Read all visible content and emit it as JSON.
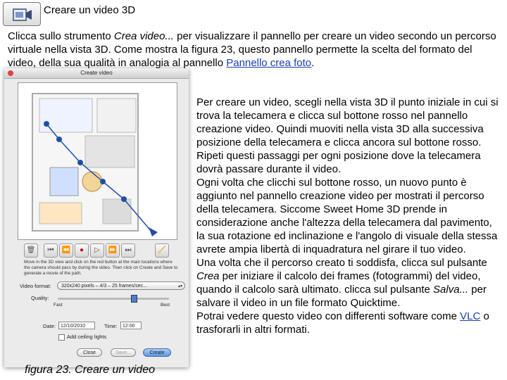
{
  "header": {
    "title": "Creare un video 3D",
    "icon": "video-camera-icon"
  },
  "intro": {
    "part1": "Clicca sullo strumento ",
    "tool": "Crea video...",
    "part2": " per visualizzare il pannello per creare un video secondo un percorso virtuale nella vista 3D. Come mostra la figura 23, questo pannello permette la scelta del formato del video, della sua qualità in analogia al pannello ",
    "link": "Pannello crea foto",
    "part3": "."
  },
  "body": {
    "p1": "Per creare un video, scegli nella vista 3D il punto iniziale in cui si trova la telecamera e clicca sul bottone rosso nel pannello creazione video. Quindi muoviti nella vista 3D alla successiva posizione della telecamera e clicca ancora sul bottone rosso. Ripeti questi passaggi per ogni posizione dove la telecamera dovrà passare durante il video.",
    "p2": "Ogni volta che clicchi sul bottone rosso, un nuovo punto è aggiunto nel pannello creazione video per mostrati il percorso della telecamera. Siccome Sweet Home 3D prende in considerazione anche l'altezza della telecamera dal pavimento, la sua rotazione ed inclinazione e l'angolo di visuale della stessa avrete ampia libertà di inquadratura nel girare il tuo video.",
    "p3_a": "Una volta che il percorso creato ti soddisfa, clicca sul pulsante ",
    "p3_crea": "Crea",
    "p3_b": " per iniziare il calcolo dei frames (fotogrammi) del video, quando il calcolo sarà ultimato. clicca sul pulsante ",
    "p3_salva": "Salva...",
    "p3_c": " per salvare il video in un file formato Quicktime.",
    "p4_a": "Potrai vedere questo video con differenti software come ",
    "p4_link": "VLC",
    "p4_b": " o trasforarli in altri formati."
  },
  "caption": "figura 23. Creare un video",
  "dialog": {
    "title": "Create video",
    "help": "Move in the 3D view and click on the red button at the main locations where the camera should pass by during the video. Then click on Create and Save to generate a movie of the path.",
    "format_label": "Video format:",
    "format_value": "320x240 pixels – 4/3 – 25 frames/sec...",
    "quality_label": "Quality:",
    "quality_fast": "Fast",
    "quality_best": "Best",
    "date_label": "Date:",
    "date_value": "12/10/2010",
    "time_label": "Time:",
    "time_value": "12:00",
    "ceiling_label": "Add ceiling lights",
    "close": "Close",
    "save": "Save...",
    "create": "Create"
  },
  "colors": {
    "record": "#d0021b",
    "path": "#1f4fa8",
    "link": "#1a3fb4"
  }
}
